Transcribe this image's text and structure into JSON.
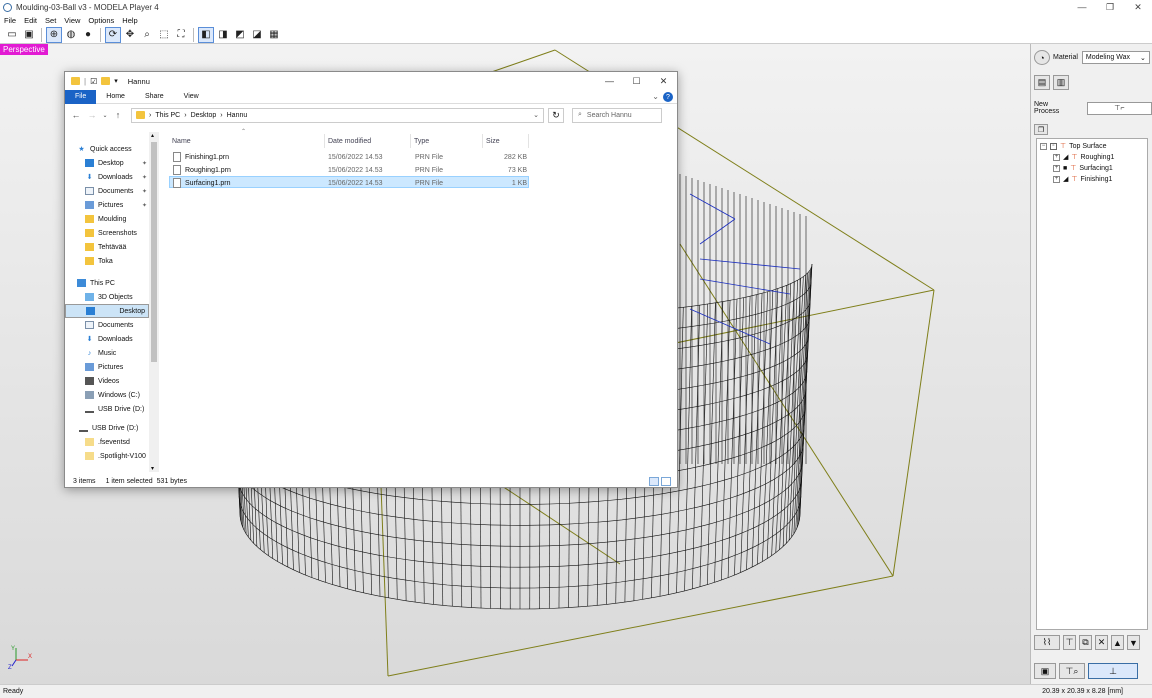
{
  "window": {
    "title": "Moulding-03-Ball v3 - MODELA Player 4"
  },
  "menu": [
    "File",
    "Edit",
    "Set",
    "View",
    "Options",
    "Help"
  ],
  "viewport": {
    "mode_label": "Perspective",
    "axis_labels": {
      "y": "Y",
      "x": "X",
      "z": "Z"
    }
  },
  "right_panel": {
    "material_label": "Material",
    "material_value": "Modeling Wax",
    "new_process_label": "New Process",
    "tree": {
      "root": "Top Surface",
      "children": [
        "Roughing1",
        "Surfacing1",
        "Finishing1"
      ]
    }
  },
  "status": {
    "left": "Ready",
    "right": "20.39 x 20.39 x 8.28 [mm]"
  },
  "explorer": {
    "title": "Hannu",
    "ribbon_tabs": [
      "File",
      "Home",
      "Share",
      "View"
    ],
    "breadcrumb": [
      "This PC",
      "Desktop",
      "Hannu"
    ],
    "search_placeholder": "Search Hannu",
    "columns": [
      "Name",
      "Date modified",
      "Type",
      "Size"
    ],
    "files": [
      {
        "name": "Finishing1.prn",
        "date": "15/06/2022 14.53",
        "type": "PRN File",
        "size": "282 KB"
      },
      {
        "name": "Roughing1.prn",
        "date": "15/06/2022 14.53",
        "type": "PRN File",
        "size": "73 KB"
      },
      {
        "name": "Surfacing1.prn",
        "date": "15/06/2022 14.53",
        "type": "PRN File",
        "size": "1 KB"
      }
    ],
    "nav": {
      "quick_access": "Quick access",
      "quick_items": [
        "Desktop",
        "Downloads",
        "Documents",
        "Pictures",
        "Moulding",
        "Screenshots",
        "Tehtävää",
        "Toka"
      ],
      "this_pc": "This PC",
      "pc_items": [
        "3D Objects",
        "Desktop",
        "Documents",
        "Downloads",
        "Music",
        "Pictures",
        "Videos",
        "Windows (C:)",
        "USB Drive (D:)"
      ],
      "usb": "USB Drive (D:)",
      "usb_items": [
        ".fseventsd",
        ".Spotlight-V100"
      ]
    },
    "status": {
      "items": "3 items",
      "selected": "1 item selected",
      "bytes": "531 bytes"
    }
  },
  "colors": {
    "perspective_badge": "#e21bd3",
    "accent": "#1a63c6",
    "bbox": "#7f7f1a"
  }
}
